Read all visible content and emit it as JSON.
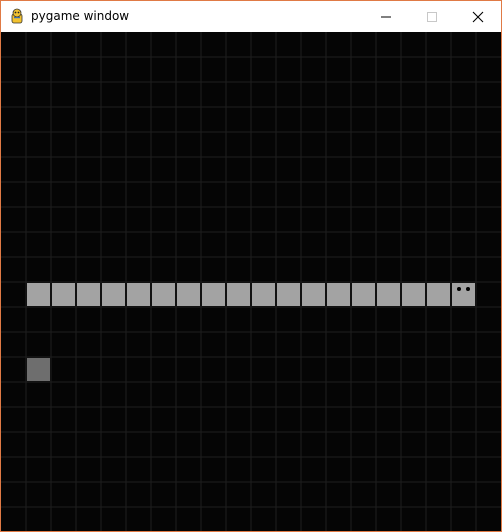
{
  "window": {
    "title": "pygame window",
    "accent_border": "#e07a45",
    "icon": "pygame-snake-icon",
    "controls": [
      "minimize-icon",
      "maximize-icon",
      "close-icon"
    ]
  },
  "game": {
    "background": "#050505",
    "grid_color": "#1e1e1e",
    "grid_columns": 20,
    "grid_rows": 20,
    "snake": {
      "color": "#a3a3a3",
      "eye_color": "#000000",
      "head": [
        18,
        10
      ],
      "segments": [
        [
          1,
          10
        ],
        [
          2,
          10
        ],
        [
          3,
          10
        ],
        [
          4,
          10
        ],
        [
          5,
          10
        ],
        [
          6,
          10
        ],
        [
          7,
          10
        ],
        [
          8,
          10
        ],
        [
          9,
          10
        ],
        [
          10,
          10
        ],
        [
          11,
          10
        ],
        [
          12,
          10
        ],
        [
          13,
          10
        ],
        [
          14,
          10
        ],
        [
          15,
          10
        ],
        [
          16,
          10
        ],
        [
          17,
          10
        ],
        [
          18,
          10
        ]
      ],
      "direction": "right"
    },
    "food": {
      "color": "#6e6e6e",
      "cell": [
        1,
        13
      ]
    }
  }
}
